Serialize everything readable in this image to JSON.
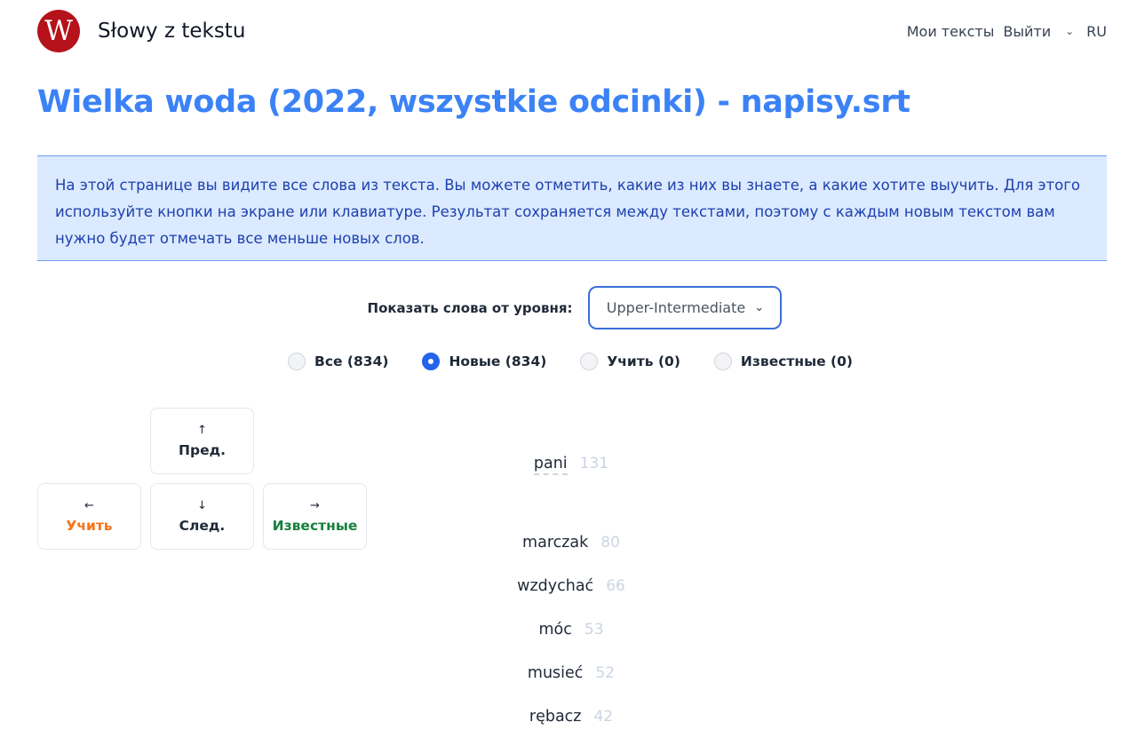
{
  "header": {
    "logo_letter": "W",
    "brand": "Słowy z tekstu",
    "nav": {
      "my_texts": "Мои тексты",
      "logout": "Выйти",
      "language": "RU"
    }
  },
  "page_title": "Wielka woda (2022, wszystkie odcinki) - napisy.srt",
  "notice": "На этой странице вы видите все слова из текста. Вы можете отметить, какие из них вы знаете, а какие хотите выучить. Для этого используйте кнопки на экране или клавиатуре. Результат сохраняется между текстами, поэтому с каждым новым текстом вам нужно будет отмечать все меньше новых слов.",
  "level": {
    "label": "Показать слова от уровня:",
    "selected": "Upper-Intermediate"
  },
  "filters": [
    {
      "label": "Все (834)",
      "checked": false
    },
    {
      "label": "Новые (834)",
      "checked": true
    },
    {
      "label": "Учить (0)",
      "checked": false
    },
    {
      "label": "Известные (0)",
      "checked": false
    }
  ],
  "keys": {
    "prev": {
      "arrow": "↑",
      "label": "Пред."
    },
    "next": {
      "arrow": "↓",
      "label": "След."
    },
    "learn": {
      "arrow": "←",
      "label": "Учить"
    },
    "known": {
      "arrow": "→",
      "label": "Известные"
    }
  },
  "words": [
    {
      "word": "pani",
      "count": "131",
      "active": true
    },
    {
      "word": "marczak",
      "count": "80",
      "active": false
    },
    {
      "word": "wzdychać",
      "count": "66",
      "active": false
    },
    {
      "word": "móc",
      "count": "53",
      "active": false
    },
    {
      "word": "musieć",
      "count": "52",
      "active": false
    },
    {
      "word": "rębacz",
      "count": "42",
      "active": false
    }
  ],
  "colors": {
    "accent": "#3b82f6",
    "logo": "#b5121b",
    "notice_bg": "#dbeafe",
    "learn": "#f97316",
    "known": "#15803d"
  }
}
